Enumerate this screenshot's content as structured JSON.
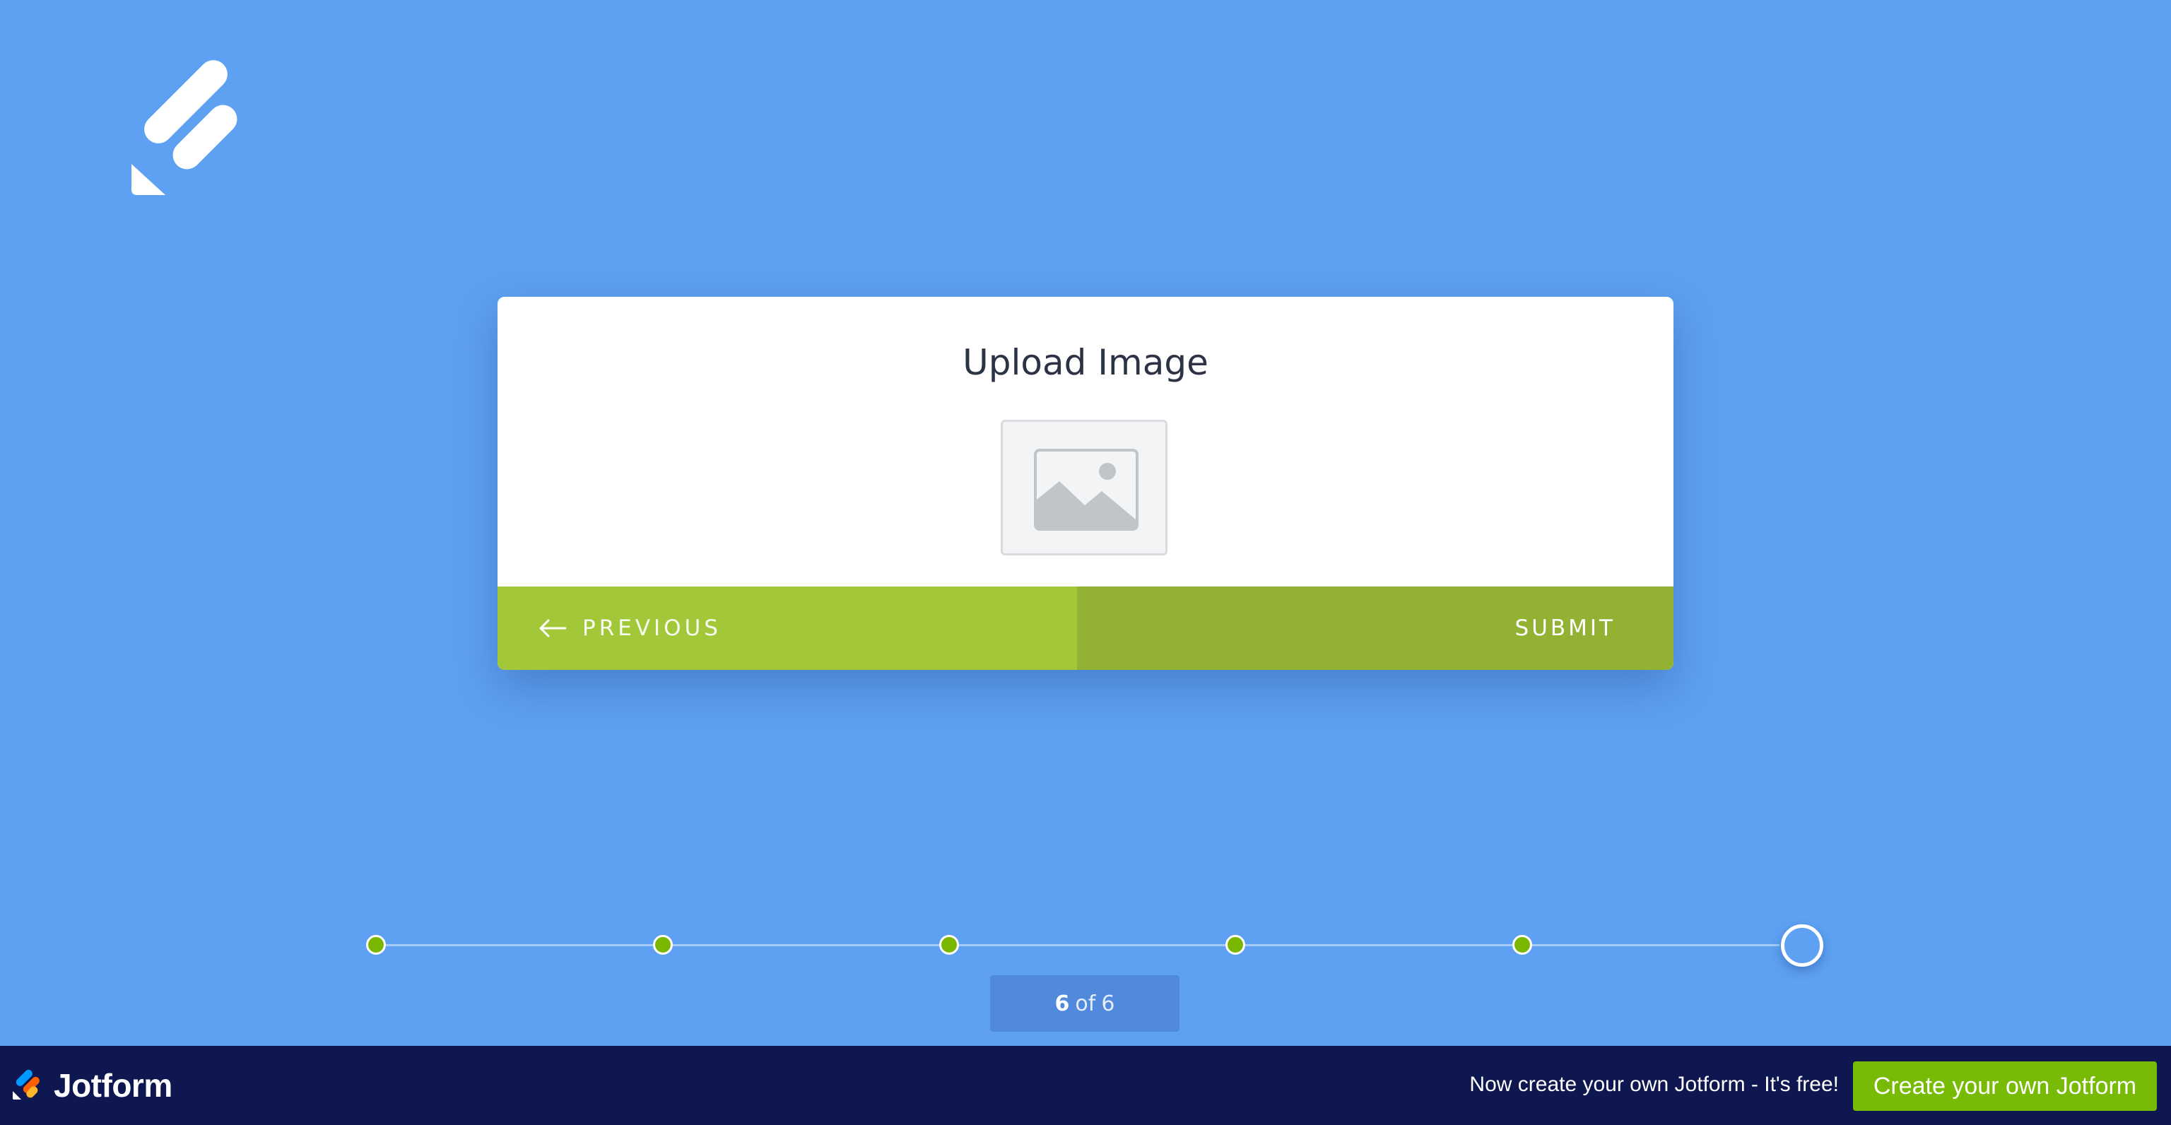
{
  "header": {
    "logo_icon": "jotform-logo-icon"
  },
  "form": {
    "title": "Upload Image",
    "image_icon": "image-placeholder-icon",
    "previous_label": "PREVIOUS",
    "submit_label": "SUBMIT"
  },
  "progress": {
    "current": "6",
    "of_label": "of",
    "total": "6",
    "steps": 6,
    "completed_color": "#7ab800"
  },
  "footer": {
    "brand_name": "Jotform",
    "promo_text": "Now create your own Jotform - It's free!",
    "cta_label": "Create your own Jotform"
  },
  "colors": {
    "background": "#5ea0f1",
    "previous_button": "#a2c83a",
    "submit_button": "#93b234",
    "footer_bar": "#0f1750",
    "cta_button": "#78bb07"
  }
}
